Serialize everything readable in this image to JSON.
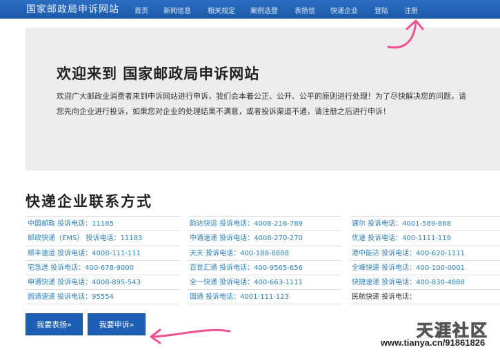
{
  "navbar": {
    "brand": "国家邮政局申诉网站",
    "items": [
      "首页",
      "新闻信息",
      "相关规定",
      "案例选登",
      "表扬信",
      "快递企业",
      "登陆",
      "注册"
    ]
  },
  "jumbotron": {
    "title": "欢迎来到  国家邮政局申诉网站",
    "text": "欢迎广大邮政业消费者来到申诉网站进行申诉，我们会本着公正、公开、公平的原则进行处理！为了尽快解决您的问题，请您先向企业进行投诉，如果您对企业的处理结果不满意，或者投诉渠道不通，请注册之后进行申诉！"
  },
  "section": {
    "title": "快递企业联系方式"
  },
  "contacts": {
    "col1": [
      "中国邮政  投诉电话：11185",
      "邮政快递（EMS）  投诉电话：11183",
      "顺丰速运  投诉电话：4008-111-111",
      "宅急送  投诉电话：400-678-9000",
      "申通快递  投诉电话：4008-895-543",
      "圆通速递  投诉电话：95554"
    ],
    "col2": [
      "韵达快运  投诉电话：4008-216-789",
      "中通速递  投诉电话：4008-270-270",
      "天天  投诉电话：400-188-8888",
      "百世汇通  投诉电话：400-9565-656",
      "全一快递  投诉电话：400-663-1111",
      "国通  投诉电话：4001-111-123"
    ],
    "col3": [
      "速尔  投诉电话：4001-589-888",
      "优速  投诉电话：400-1111-119",
      "港中能达  投诉电话：400-620-1111",
      "全峰快递  投诉电话：400-100-0001",
      "快捷速递  投诉电话：400-830-4888",
      "民航快递  投诉电话："
    ]
  },
  "buttons": {
    "praise": "我要表扬»",
    "complain": "我要申诉»"
  },
  "watermark": {
    "logo": "天涯社区",
    "url": "www.tianya.cn/91861826"
  },
  "colors": {
    "navbar": "#1d5aa8",
    "link": "#2f7fb6",
    "button": "#1c5fb4",
    "annotation": "#f0508f"
  }
}
